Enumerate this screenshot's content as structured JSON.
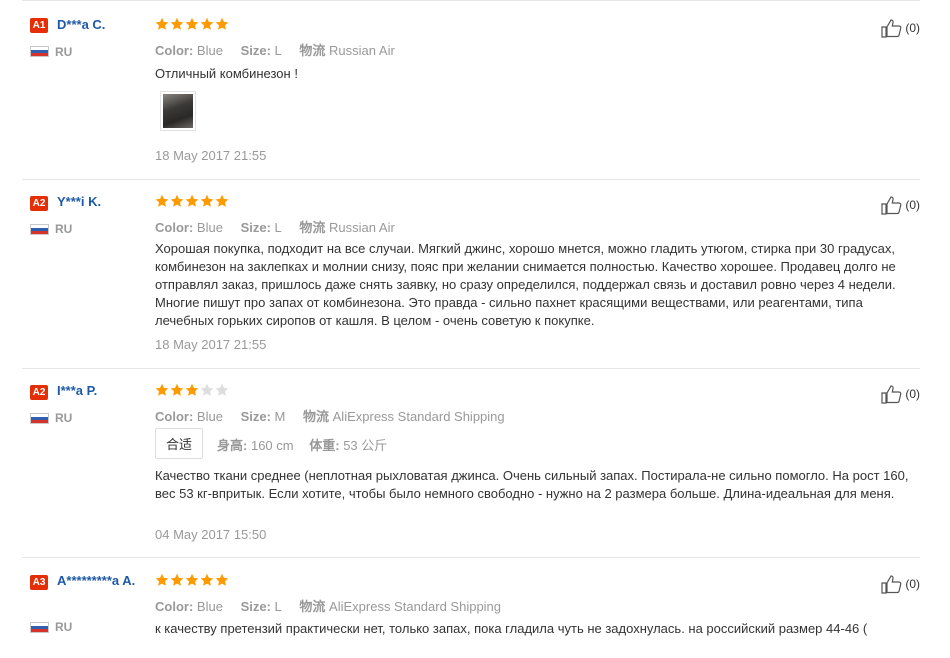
{
  "reviews": [
    {
      "badge": "A1",
      "user": "D***a C.",
      "country": "RU",
      "rating": 5,
      "color_label": "Color:",
      "color_value": "Blue",
      "size_label": "Size:",
      "size_value": "L",
      "ship_label": "物流",
      "ship_value": "Russian Air",
      "text": "Отличный комбинезон !",
      "has_photo": true,
      "date": "18 May 2017 21:55",
      "helpful_count": "(0)"
    },
    {
      "badge": "A2",
      "user": "Y***i K.",
      "country": "RU",
      "rating": 5,
      "color_label": "Color:",
      "color_value": "Blue",
      "size_label": "Size:",
      "size_value": "L",
      "ship_label": "物流",
      "ship_value": "Russian Air",
      "text": "Хорошая покупка, подходит на все случаи. Мягкий джинс, хорошо мнется, можно гладить утюгом, стирка при 30 градусах, комбинезон на заклепках и молнии снизу, пояс при желании снимается полностью. Качество хорошее. Продавец долго не отправлял заказ, пришлось даже снять заявку, но сразу определился, поддержал связь и доставил ровно через 4 недели. Многие пишут про запах от комбинезона. Это правда - сильно пахнет красящими веществами, или реагентами, типа лечебных горьких сиропов от кашля. В целом - очень советую к покупке.",
      "date": "18 May 2017 21:55",
      "helpful_count": "(0)"
    },
    {
      "badge": "A2",
      "user": "I***a P.",
      "country": "RU",
      "rating": 3,
      "color_label": "Color:",
      "color_value": "Blue",
      "size_label": "Size:",
      "size_value": "M",
      "ship_label": "物流",
      "ship_value": "AliExpress Standard Shipping",
      "fit_tag": "合适",
      "height_label": "身高:",
      "height_value": "160 cm",
      "weight_label": "体重:",
      "weight_value": "53 公斤",
      "text": "Качество ткани среднее (неплотная рыхловатая джинса. Очень сильный запах. Постирала-не сильно помогло. На рост 160, вес 53 кг-впритык. Если хотите, чтобы было немного свободно - нужно на 2 размера больше. Длина-идеальная для меня.",
      "date": "04 May 2017 15:50",
      "helpful_count": "(0)"
    },
    {
      "badge": "A3",
      "user": "A*********a A.",
      "country": "RU",
      "rating": 5,
      "color_label": "Color:",
      "color_value": "Blue",
      "size_label": "Size:",
      "size_value": "L",
      "ship_label": "物流",
      "ship_value": "AliExpress Standard Shipping",
      "text": "к качеству претензий практически нет, только запах, пока гладила чуть не задохнулась. на российский размер 44-46 (",
      "helpful_count": "(0)"
    }
  ],
  "colors": {
    "accent": "#e62e04",
    "star": "#ff9a00",
    "link": "#1e59a8"
  }
}
